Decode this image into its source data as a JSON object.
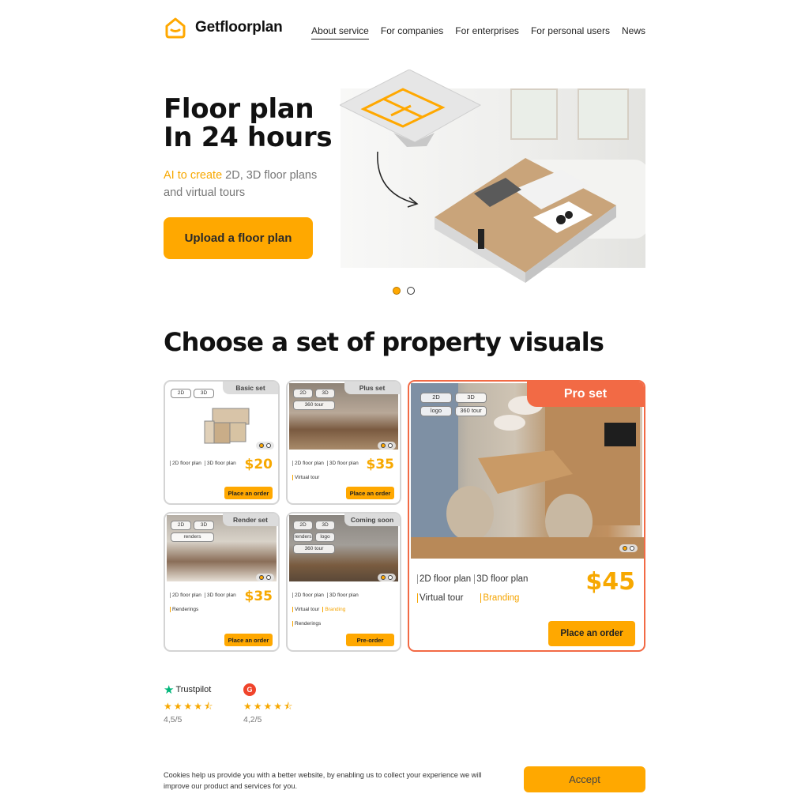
{
  "header": {
    "brand": "Getfloorplan",
    "nav": [
      {
        "label": "About service",
        "active": true
      },
      {
        "label": "For companies",
        "active": false
      },
      {
        "label": "For enterprises",
        "active": false
      },
      {
        "label": "For personal users",
        "active": false
      },
      {
        "label": "News",
        "active": false
      }
    ]
  },
  "hero": {
    "title_line1": "Floor plan",
    "title_line2": "In 24 hours",
    "subtitle_accent": "AI to create",
    "subtitle_rest": " 2D, 3D floor plans and virtual tours",
    "cta": "Upload a floor plan",
    "slides": {
      "count": 2,
      "active": 1
    }
  },
  "sets": {
    "title": "Choose a set of property visuals",
    "cards": {
      "basic": {
        "tag": "Basic set",
        "chips": [
          "2D",
          "3D"
        ],
        "features_row1": [
          "2D floor plan",
          "3D floor plan"
        ],
        "features_row2": [],
        "features_row3": [],
        "price": "$20",
        "button": "Place an order"
      },
      "plus": {
        "tag": "Plus set",
        "chips": [
          "2D",
          "3D",
          "360 tour"
        ],
        "features_row1": [
          "2D floor plan",
          "3D floor plan"
        ],
        "features_row2": [
          "Virtual tour"
        ],
        "features_row3": [],
        "price": "$35",
        "button": "Place an order"
      },
      "render": {
        "tag": "Render set",
        "chips": [
          "2D",
          "3D",
          "renders"
        ],
        "features_row1": [
          "2D floor plan",
          "3D floor plan"
        ],
        "features_row2": [
          "Renderings"
        ],
        "features_row3": [],
        "price": "$35",
        "button": "Place an order"
      },
      "soon": {
        "tag": "Coming soon",
        "chips": [
          "2D",
          "3D",
          "renders",
          "logo",
          "360 tour"
        ],
        "features_row1": [
          "2D floor plan",
          "3D floor plan"
        ],
        "features_row2": [
          "Virtual tour",
          "Branding"
        ],
        "features_row3": [
          "Renderings"
        ],
        "price": "",
        "button": "Pre-order"
      },
      "pro": {
        "tag": "Pro set",
        "chips": [
          "2D",
          "3D",
          "logo",
          "360 tour"
        ],
        "features_row1": [
          "2D floor plan",
          "3D floor plan"
        ],
        "features_row2": [
          "Virtual tour",
          "Branding"
        ],
        "price": "$45",
        "button": "Place an order"
      }
    }
  },
  "ratings": [
    {
      "brand": "Trustpilot",
      "stars": 4.5,
      "score": "4,5/5"
    },
    {
      "brand": "G2",
      "stars": 4.5,
      "score": "4,2/5"
    }
  ],
  "cookie": {
    "text": "Cookies help us provide you with a better website, by enabling us to collect your experience we will improve our product and services for you.",
    "accept": "Accept"
  },
  "colors": {
    "accent": "#ffa800",
    "pro": "#f26a45",
    "text": "#111111"
  }
}
